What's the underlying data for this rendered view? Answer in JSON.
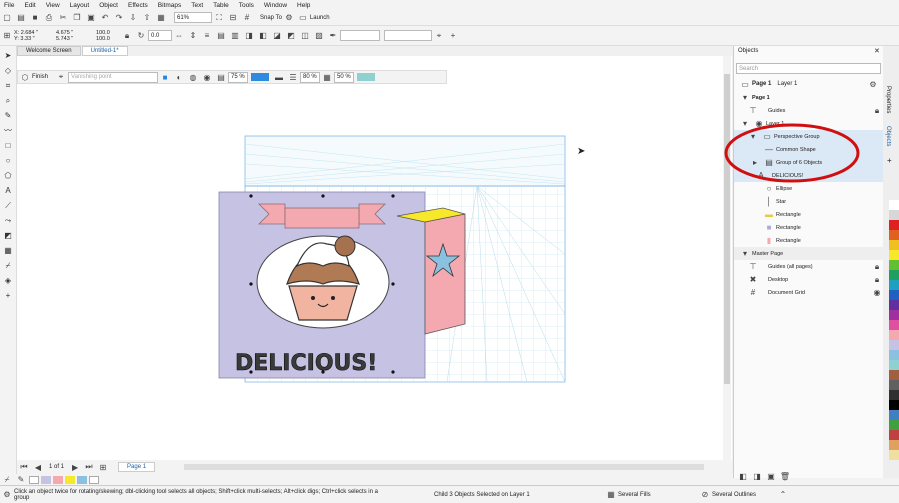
{
  "menu": [
    "File",
    "Edit",
    "View",
    "Layout",
    "Object",
    "Effects",
    "Bitmaps",
    "Text",
    "Table",
    "Tools",
    "Window",
    "Help"
  ],
  "toolbar": {
    "zoom": "61%",
    "snap_to": "Snap To",
    "launch": "Launch"
  },
  "coords": {
    "x": "X: 2.684 \"",
    "y": "Y: 3.33 \"",
    "w": "4.675 \"",
    "h": "5.743 \"",
    "sx": "100.0",
    "sy": "100.0",
    "angle": "0.0"
  },
  "tabs": [
    "Welcome Screen",
    "Untitled-1*"
  ],
  "property_bar": {
    "finish": "Finish",
    "mode_placeholder": "Vanishing point",
    "opacity1": "75 %",
    "opacity2": "80 %",
    "opacity3": "50 %"
  },
  "artwork": {
    "text": "DELICIOUS!"
  },
  "objects_docker": {
    "title": "Objects",
    "search_placeholder": "Search",
    "page_header": {
      "page": "Page 1",
      "layer": "Layer 1"
    },
    "rows": [
      {
        "label": "Page 1",
        "indent": 0
      },
      {
        "label": "Guides",
        "indent": 1
      },
      {
        "label": "Layer 1",
        "indent": 1
      },
      {
        "label": "Perspective Group",
        "indent": 2
      },
      {
        "label": "Common Shape",
        "indent": 3
      },
      {
        "label": "Group of 6 Objects",
        "indent": 3
      },
      {
        "label": "DELICIOUS!",
        "indent": 3
      },
      {
        "label": "Ellipse",
        "indent": 3
      },
      {
        "label": "Star",
        "indent": 3
      },
      {
        "label": "Rectangle",
        "indent": 3
      },
      {
        "label": "Rectangle",
        "indent": 3
      },
      {
        "label": "Rectangle",
        "indent": 3
      },
      {
        "label": "Master Page",
        "indent": 0
      },
      {
        "label": "Guides (all pages)",
        "indent": 1
      },
      {
        "label": "Desktop",
        "indent": 1
      },
      {
        "label": "Document Grid",
        "indent": 1
      }
    ],
    "side_tabs": [
      "Properties",
      "Objects"
    ]
  },
  "pagebar": {
    "count": "1 of 1",
    "page_tab": "Page 1"
  },
  "status": {
    "hint": "Click an object twice for rotating/skewing; dbl-clicking tool selects all objects; Shift+click multi-selects; Alt+click digs; Ctrl+click selects in a group",
    "selection": "Child 3 Objects Selected on Layer 1",
    "fill": "Several Fills",
    "outline": "Several Outlines"
  },
  "colors": {
    "accent": "#1b5fa8",
    "highlight_circle": "#d01010",
    "card": "#c5c2e4",
    "banner": "#f4a9b0",
    "box_top": "#f7e92a",
    "box_side": "#f4a9b0",
    "grid": "#9fd3e6"
  }
}
